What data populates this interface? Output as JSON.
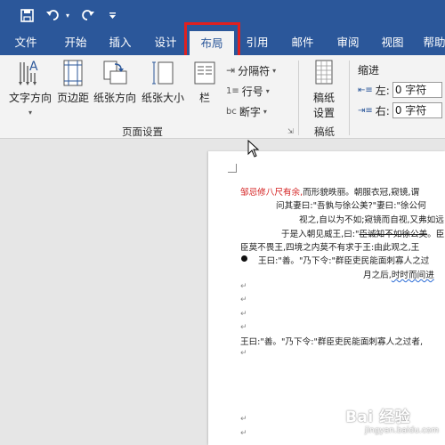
{
  "qat": {
    "save_icon": "save-icon",
    "undo_icon": "undo-icon",
    "redo_icon": "redo-icon",
    "customize_icon": "customize-qat-icon"
  },
  "tabs": [
    {
      "label": "文件"
    },
    {
      "label": "开始"
    },
    {
      "label": "插入"
    },
    {
      "label": "设计"
    },
    {
      "label": "布局"
    },
    {
      "label": "引用"
    },
    {
      "label": "邮件"
    },
    {
      "label": "审阅"
    },
    {
      "label": "视图"
    },
    {
      "label": "帮助"
    }
  ],
  "ribbon": {
    "page_setup": {
      "text_direction": "文字方向",
      "margins": "页边距",
      "orientation": "纸张方向",
      "size": "纸张大小",
      "columns": "栏",
      "breaks": "分隔符",
      "line_numbers": "行号",
      "hyphenation": "断字",
      "group_label": "页面设置"
    },
    "manuscript": {
      "button": "稿纸\n设置",
      "btn_line1": "稿纸",
      "btn_line2": "设置",
      "group_label": "稿纸"
    },
    "indent": {
      "label": "缩进",
      "left_label": "左:",
      "left_value": "0 字符",
      "right_label": "右:",
      "right_value": "0 字符"
    }
  },
  "document": {
    "line1_red": "邹忌修八尺有余,",
    "line1_rest": "而形貌昳丽。朝服衣冠,窥镜,谓",
    "line2": "问其妻曰:\"吾孰与徐公美?\"妻曰:\"徐公何",
    "line3": "视之,自以为不如;窥镜而自视,又弗如远",
    "line4_a": "于是入朝见威王,曰:\"",
    "line4_strike": "臣诚知不如徐公美",
    "line4_b": "。臣之",
    "line5": "臣莫不畏王,四境之内莫不有求于王:由此观之,王",
    "bullet_line": "王曰:\"善。\"乃下令:\"群臣吏民能面刺寡人之过",
    "line7_a": "月之后,",
    "line7_b": "时时而间进",
    "line8": "王曰:\"善。\"乃下令:\"群臣吏民能面刺寡人之过者,",
    "paragraph_mark": "↵"
  },
  "watermark": {
    "brand": "Bai 经验",
    "domain": "jingyan.baidu.com"
  },
  "colors": {
    "accent": "#2b579a",
    "highlight_box": "#e02020",
    "red_text": "#d42020"
  }
}
